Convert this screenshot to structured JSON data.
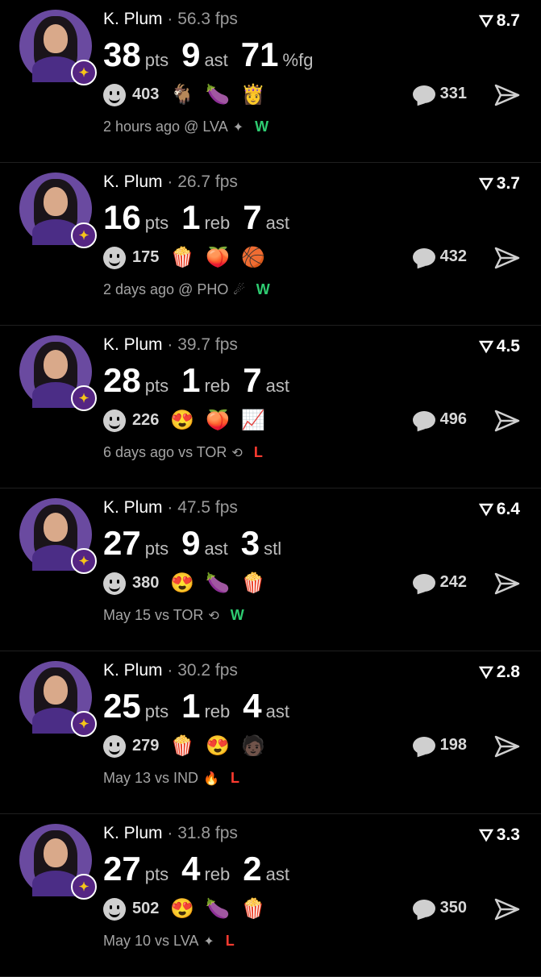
{
  "accent": {
    "win": "#2ecc71",
    "loss": "#ff3b30",
    "badge": "#552583"
  },
  "posts": [
    {
      "player": "K. Plum",
      "fps": "· 56.3 fps",
      "score": "8.7",
      "stats": [
        {
          "v": "38",
          "u": "pts"
        },
        {
          "v": "9",
          "u": "ast"
        },
        {
          "v": "71",
          "u": "%fg"
        }
      ],
      "reactions": "403",
      "emojis": [
        "🐐",
        "🍆",
        "👸"
      ],
      "comments": "331",
      "meta": "2 hours ago @ LVA",
      "team_icon": "✦",
      "result": "W"
    },
    {
      "player": "K. Plum",
      "fps": "· 26.7 fps",
      "score": "3.7",
      "stats": [
        {
          "v": "16",
          "u": "pts"
        },
        {
          "v": "1",
          "u": "reb"
        },
        {
          "v": "7",
          "u": "ast"
        }
      ],
      "reactions": "175",
      "emojis": [
        "🍿",
        "🍑",
        "🏀"
      ],
      "comments": "432",
      "meta": "2 days ago @ PHO",
      "team_icon": "☄",
      "result": "W"
    },
    {
      "player": "K. Plum",
      "fps": "· 39.7 fps",
      "score": "4.5",
      "stats": [
        {
          "v": "28",
          "u": "pts"
        },
        {
          "v": "1",
          "u": "reb"
        },
        {
          "v": "7",
          "u": "ast"
        }
      ],
      "reactions": "226",
      "emojis": [
        "😍",
        "🍑",
        "📈"
      ],
      "comments": "496",
      "meta": "6 days ago vs TOR",
      "team_icon": "⟲",
      "result": "L"
    },
    {
      "player": "K. Plum",
      "fps": "· 47.5 fps",
      "score": "6.4",
      "stats": [
        {
          "v": "27",
          "u": "pts"
        },
        {
          "v": "9",
          "u": "ast"
        },
        {
          "v": "3",
          "u": "stl"
        }
      ],
      "reactions": "380",
      "emojis": [
        "😍",
        "🍆",
        "🍿"
      ],
      "comments": "242",
      "meta": "May 15 vs TOR",
      "team_icon": "⟲",
      "result": "W"
    },
    {
      "player": "K. Plum",
      "fps": "· 30.2 fps",
      "score": "2.8",
      "stats": [
        {
          "v": "25",
          "u": "pts"
        },
        {
          "v": "1",
          "u": "reb"
        },
        {
          "v": "4",
          "u": "ast"
        }
      ],
      "reactions": "279",
      "emojis": [
        "🍿",
        "😍",
        "🧑🏿"
      ],
      "comments": "198",
      "meta": "May 13 vs IND",
      "team_icon": "🔥",
      "result": "L"
    },
    {
      "player": "K. Plum",
      "fps": "· 31.8 fps",
      "score": "3.3",
      "stats": [
        {
          "v": "27",
          "u": "pts"
        },
        {
          "v": "4",
          "u": "reb"
        },
        {
          "v": "2",
          "u": "ast"
        }
      ],
      "reactions": "502",
      "emojis": [
        "😍",
        "🍆",
        "🍿"
      ],
      "comments": "350",
      "meta": "May 10 vs LVA",
      "team_icon": "✦",
      "result": "L"
    }
  ]
}
